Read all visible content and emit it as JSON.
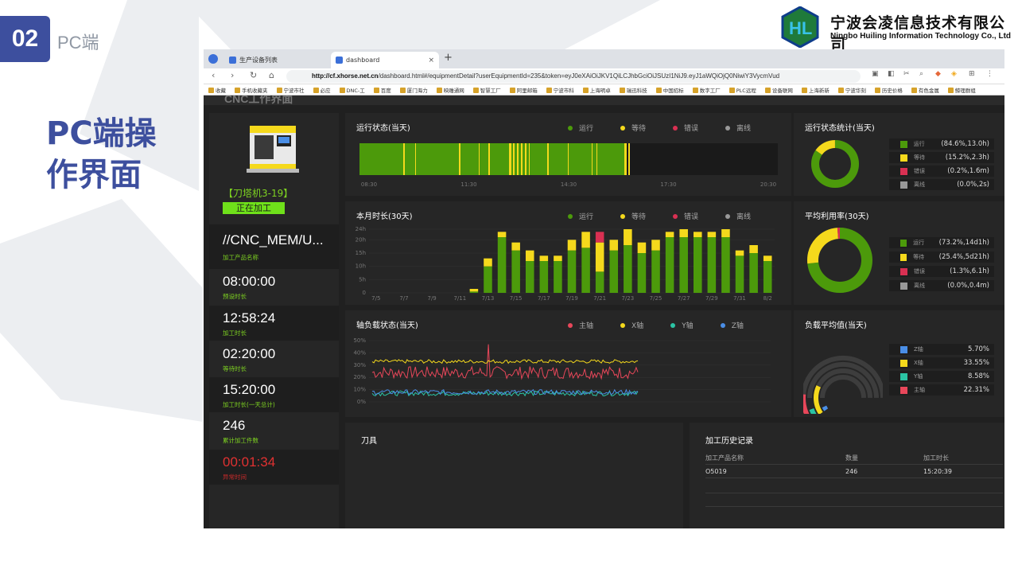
{
  "slide": {
    "badge": "02",
    "subtitle": "PC端",
    "title": "PC端操作界面",
    "company_cn": "宁波会凌信息技术有限公司",
    "company_en": "Ningbo Huiling Information Technology Co., Ltd"
  },
  "browser": {
    "tabs": [
      {
        "label": "生产设备列表"
      },
      {
        "label": "dashboard"
      }
    ],
    "new_tab": "+",
    "tab_close": "×",
    "url_host": "http://cf.xhorse.net.cn",
    "url_rest": "/dashboard.html#/equipmentDetail?userEquipmentId=235&token=eyJ0eXAiOiJKV1QiLCJhbGciOiJSUzI1NiJ9.eyJ1aWQiOjQ0NiwiY3VycmVud",
    "bookmarks": [
      "收藏",
      "手机收藏夹",
      "宁波市社",
      "必应",
      "DNC-工",
      "百度",
      "厦门海力",
      "映雕通网",
      "智慧工厂",
      "阿里邮箱",
      "宁波市科",
      "上海明卓",
      "瑞迅科技",
      "中国招标",
      "数字工厂",
      "PLC远程",
      "设备联网",
      "上海新新",
      "宁波华刻",
      "历史价格",
      "有色金属",
      "鲸理群组"
    ]
  },
  "dashboard": {
    "header_title": "CNC工作界面",
    "machine": {
      "name": "【刀塔机3-19】",
      "status": "正在加工",
      "kv": [
        {
          "value": "//CNC_MEM/U...",
          "label": "加工产品名称"
        },
        {
          "value": "08:00:00",
          "label": "预设时长"
        },
        {
          "value": "12:58:24",
          "label": "加工时长"
        },
        {
          "value": "02:20:00",
          "label": "等待时长"
        },
        {
          "value": "15:20:00",
          "label": "加工时长(一天总计)"
        },
        {
          "value": "246",
          "label": "累计加工件数"
        },
        {
          "value": "00:01:34",
          "label": "异常时间"
        }
      ]
    },
    "status_legend": [
      {
        "label": "运行",
        "color": "#4c9a0b"
      },
      {
        "label": "等待",
        "color": "#f5d91c"
      },
      {
        "label": "错误",
        "color": "#d93052"
      },
      {
        "label": "离线",
        "color": "#999999"
      }
    ],
    "run_status": {
      "title": "运行状态(当天)",
      "ticks": [
        "08:30",
        "11:30",
        "14:30",
        "17:30",
        "20:30"
      ]
    },
    "run_stats": {
      "title": "运行状态统计(当天)",
      "rows": [
        {
          "label": "运行",
          "value": "(84.6%,13.0h)",
          "color": "#4c9a0b"
        },
        {
          "label": "等待",
          "value": "(15.2%,2.3h)",
          "color": "#f5d91c"
        },
        {
          "label": "错误",
          "value": "(0.2%,1.6m)",
          "color": "#d93052"
        },
        {
          "label": "离线",
          "value": "(0.0%,2s)",
          "color": "#999999"
        }
      ]
    },
    "monthly": {
      "title": "本月时长(30天)"
    },
    "avg_util": {
      "title": "平均利用率(30天)",
      "rows": [
        {
          "label": "运行",
          "value": "(73.2%,14d1h)",
          "color": "#4c9a0b"
        },
        {
          "label": "等待",
          "value": "(25.4%,5d21h)",
          "color": "#f5d91c"
        },
        {
          "label": "错误",
          "value": "(1.3%,6.1h)",
          "color": "#d93052"
        },
        {
          "label": "离线",
          "value": "(0.0%,0.4m)",
          "color": "#999999"
        }
      ]
    },
    "axis_load": {
      "title": "轴负载状态(当天)",
      "legend": [
        {
          "label": "主轴",
          "color": "#e8475a"
        },
        {
          "label": "X轴",
          "color": "#f5d91c"
        },
        {
          "label": "Y轴",
          "color": "#2bc4a4"
        },
        {
          "label": "Z轴",
          "color": "#4a8ee6"
        }
      ]
    },
    "load_avg": {
      "title": "负载平均值(当天)",
      "rows": [
        {
          "label": "Z轴",
          "value": "5.70%",
          "color": "#4a8ee6"
        },
        {
          "label": "X轴",
          "value": "33.55%",
          "color": "#f5d91c"
        },
        {
          "label": "Y轴",
          "value": "8.58%",
          "color": "#2bc4a4"
        },
        {
          "label": "主轴",
          "value": "22.31%",
          "color": "#e8475a"
        }
      ]
    },
    "tools": {
      "title": "刀具"
    },
    "history": {
      "title": "加工历史记录",
      "columns": [
        "加工产品名称",
        "数量",
        "加工时长"
      ],
      "rows": [
        [
          "O5019",
          "246",
          "15:20:39"
        ]
      ]
    }
  },
  "chart_data": [
    {
      "type": "bar",
      "title": "本月时长(30天)",
      "categories": [
        "7/5",
        "7/6",
        "7/7",
        "7/8",
        "7/9",
        "7/10",
        "7/11",
        "7/12",
        "7/13",
        "7/14",
        "7/15",
        "7/16",
        "7/17",
        "7/18",
        "7/19",
        "7/20",
        "7/21",
        "7/22",
        "7/23",
        "7/24",
        "7/25",
        "7/26",
        "7/27",
        "7/28",
        "7/29",
        "7/30",
        "7/31",
        "8/1",
        "8/2"
      ],
      "tick_labels": [
        "7/5",
        "7/7",
        "7/9",
        "7/11",
        "7/13",
        "7/15",
        "7/17",
        "7/19",
        "7/21",
        "7/23",
        "7/25",
        "7/27",
        "7/29",
        "7/31",
        "8/2"
      ],
      "y_ticks": [
        "0",
        "5h",
        "10h",
        "15h",
        "20h",
        "24h"
      ],
      "ylim": [
        0,
        24
      ],
      "series": [
        {
          "name": "运行",
          "values": [
            0,
            0,
            0,
            0,
            0,
            0,
            0,
            0.5,
            10,
            21,
            16,
            12,
            12,
            12,
            16,
            17,
            8,
            16,
            18,
            15,
            16,
            21,
            21,
            21,
            21,
            21,
            14,
            15,
            12
          ]
        },
        {
          "name": "等待",
          "values": [
            0,
            0,
            0,
            0,
            0,
            0,
            0,
            1,
            3,
            2,
            3,
            4,
            2,
            2,
            4,
            6,
            11,
            4,
            6,
            4,
            4,
            2,
            3,
            2,
            2,
            3,
            2,
            3,
            2
          ]
        },
        {
          "name": "错误",
          "values": [
            0,
            0,
            0,
            0,
            0,
            0,
            0,
            0,
            0,
            0,
            0,
            0,
            0,
            0,
            0,
            0,
            4,
            0,
            0,
            0,
            0,
            0,
            0,
            0,
            0,
            0,
            0,
            0,
            0
          ]
        }
      ]
    },
    {
      "type": "line",
      "title": "轴负载状态(当天)",
      "y_ticks": [
        "0%",
        "10%",
        "20%",
        "30%",
        "40%",
        "50%"
      ],
      "ylim": [
        0,
        50
      ],
      "series": [
        {
          "name": "主轴",
          "mean": 24,
          "amplitude": 5,
          "spike": 47
        },
        {
          "name": "X轴",
          "mean": 33,
          "amplitude": 1.5
        },
        {
          "name": "Y轴",
          "mean": 7,
          "amplitude": 2
        },
        {
          "name": "Z轴",
          "mean": 8,
          "amplitude": 2
        }
      ]
    }
  ]
}
